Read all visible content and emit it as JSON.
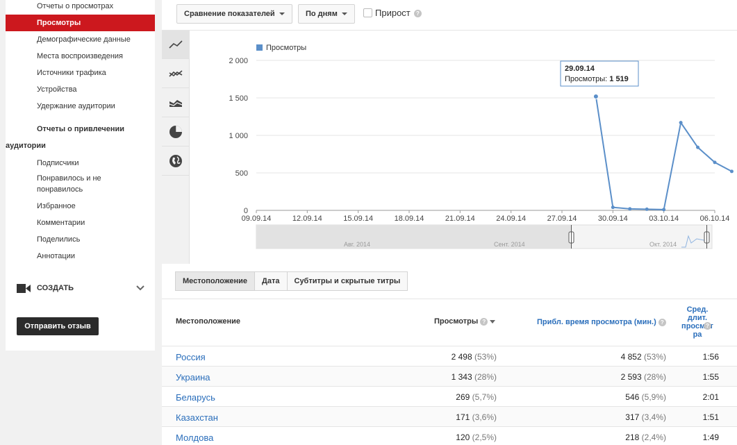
{
  "sidebar": {
    "items": [
      {
        "label": "Отчеты о просмотрах",
        "top": 2,
        "type": "sub"
      },
      {
        "label": "Просмотры",
        "top": 21,
        "type": "active"
      },
      {
        "label": "Демографические данные",
        "top": 50,
        "type": "sub"
      },
      {
        "label": "Места воспроизведения",
        "top": 74,
        "type": "sub"
      },
      {
        "label": "Источники трафика",
        "top": 98,
        "type": "sub"
      },
      {
        "label": "Устройства",
        "top": 122,
        "type": "sub"
      },
      {
        "label": "Удержание аудитории",
        "top": 146,
        "type": "sub"
      }
    ],
    "heading_line1": "Отчеты о привлечении",
    "heading_line2": "аудитории",
    "items2": [
      {
        "label": "Подписчики"
      },
      {
        "label": "Понравилось и не"
      },
      {
        "label": "понравилось"
      },
      {
        "label": "Избранное"
      },
      {
        "label": "Комментарии"
      },
      {
        "label": "Поделились"
      },
      {
        "label": "Аннотации"
      }
    ],
    "create_label": "СОЗДАТЬ",
    "feedback_label": "Отправить отзыв"
  },
  "toolbar": {
    "compare_label": "Сравнение показателей",
    "period_label": "По дням",
    "growth_label": "Прирост",
    "help": "?"
  },
  "chart_data": {
    "type": "line",
    "legend": "Просмотры",
    "legend_color": "#5b8fc9",
    "x_ticks": [
      "09.09.14",
      "12.09.14",
      "15.09.14",
      "18.09.14",
      "21.09.14",
      "24.09.14",
      "27.09.14",
      "30.09.14",
      "03.10.14",
      "06.10.14"
    ],
    "y_ticks": [
      "0",
      "500",
      "1 000",
      "1 500",
      "2 000"
    ],
    "ylim": [
      0,
      2000
    ],
    "series": [
      {
        "name": "Просмотры",
        "x": [
          "29.09.14",
          "30.09.14",
          "01.10.14",
          "02.10.14",
          "03.10.14",
          "04.10.14",
          "05.10.14",
          "06.10.14",
          "07.10.14"
        ],
        "values": [
          1519,
          40,
          20,
          15,
          10,
          1170,
          840,
          640,
          520
        ]
      }
    ],
    "tooltip": {
      "date": "29.09.14",
      "label": "Просмотры:",
      "value": "1 519"
    },
    "navigator_labels": [
      "Авг. 2014",
      "Сент. 2014",
      "Окт. 2014"
    ]
  },
  "tabs": [
    "Местоположение",
    "Дата",
    "Субтитры и скрытые титры"
  ],
  "table": {
    "headers": {
      "location": "Местоположение",
      "views": "Просмотры",
      "watch_time": "Прибл. время просмотра (мин.)",
      "avg_line1": "Сред.",
      "avg_line2": "длит.",
      "avg_line3": "просмот",
      "avg_line4": "ра"
    },
    "rows": [
      {
        "location": "Россия",
        "views": "2 498",
        "views_pct": "(53%)",
        "time": "4 852",
        "time_pct": "(53%)",
        "avg": "1:56"
      },
      {
        "location": "Украина",
        "views": "1 343",
        "views_pct": "(28%)",
        "time": "2 593",
        "time_pct": "(28%)",
        "avg": "1:55"
      },
      {
        "location": "Беларусь",
        "views": "269",
        "views_pct": "(5,7%)",
        "time": "546",
        "time_pct": "(5,9%)",
        "avg": "2:01"
      },
      {
        "location": "Казахстан",
        "views": "171",
        "views_pct": "(3,6%)",
        "time": "317",
        "time_pct": "(3,4%)",
        "avg": "1:51"
      },
      {
        "location": "Молдова",
        "views": "120",
        "views_pct": "(2,5%)",
        "time": "218",
        "time_pct": "(2,4%)",
        "avg": "1:49"
      }
    ]
  }
}
